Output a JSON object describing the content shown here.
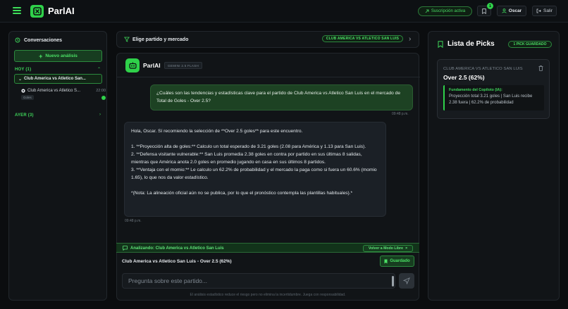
{
  "app": {
    "name": "ParlAI"
  },
  "header": {
    "subscription_label": "Suscripción activa",
    "notification_count": "1",
    "user_name": "Oscar",
    "exit_label": "Salir"
  },
  "sidebar": {
    "title": "Conversaciones",
    "new_button": "Nuevo análisis",
    "groups": [
      {
        "label": "HOY (1)"
      },
      {
        "label": "AYER (3)"
      }
    ],
    "active_item": "Club America vs Atletico San...",
    "conversation": {
      "title": "Club America vs Atletico S...",
      "time": "22:00",
      "tag": "Goles"
    }
  },
  "selector": {
    "title": "Elige partido y mercado",
    "match_pill": "CLUB AMERICA VS ATLETICO SAN LUIS"
  },
  "chat": {
    "bot_name": "ParlAI",
    "model_tag": "GEMINI 2.5 FLASH",
    "user_message": "¿Cuáles son las tendencias y estadísticas clave para el partido de Club America vs Atletico San Luis en el mercado de Total de Goles - Over 2.5?",
    "user_time": "09:48 p.m.",
    "bot_message": "Hola, Oscar. Sí recomiendo la selección de **Over 2.5 goles** para este encuentro.\n\n1. **Proyección alta de goles:** Calculo un total esperado de 3.21 goles (2.08 para América y 1.13 para San Luis).\n2. **Defensa visitante vulnerable:** San Luis promedia 2.38 goles en contra por partido en sus últimas 8 salidas, mientras que América anota 2.0 goles en promedio jugando en casa en sus últimos 8 partidos.\n3. **Ventaja con el momio:** Le calculo un 62.2% de probabilidad y el mercado la paga como si fuera un 60.6% (momio 1.65), lo que nos da valor estadístico.\n\n*(Nota: La alineación oficial aún no se publica, por lo que el pronóstico contempla las plantillas habituales).*",
    "bot_time": "09:48 p.m.",
    "analyzing_label": "Analizando: Club America vs Atletico San Luis",
    "back_label": "Volver a Modo Libre",
    "current_match": "Club America vs Atletico San Luis",
    "current_pick": "Over 2.5 (62%)",
    "saved_label": "Guardado",
    "input_placeholder": "Pregunta sobre este partido...",
    "disclaimer": "El análisis estadístico reduce el riesgo pero no elimina la incertidumbre. Juega con responsabilidad."
  },
  "picks": {
    "title": "Lista de Picks",
    "badge": "1 PICK GUARDADO",
    "items": [
      {
        "match": "CLUB AMERICA VS ATLETICO SAN LUIS",
        "pick": "Over 2.5 (62%)",
        "reason_title": "Fundamento del Copiloto (IA):",
        "reason_text": "Proyección total 3.21 goles | San Luis recibe 2.38 fuera | 62.2% de probabilidad"
      }
    ]
  },
  "colors": {
    "accent": "#2fd14a",
    "background": "#0b0d0f",
    "panel": "#111417",
    "user_bubble": "#1d4223",
    "bot_bubble": "#1b2026"
  }
}
